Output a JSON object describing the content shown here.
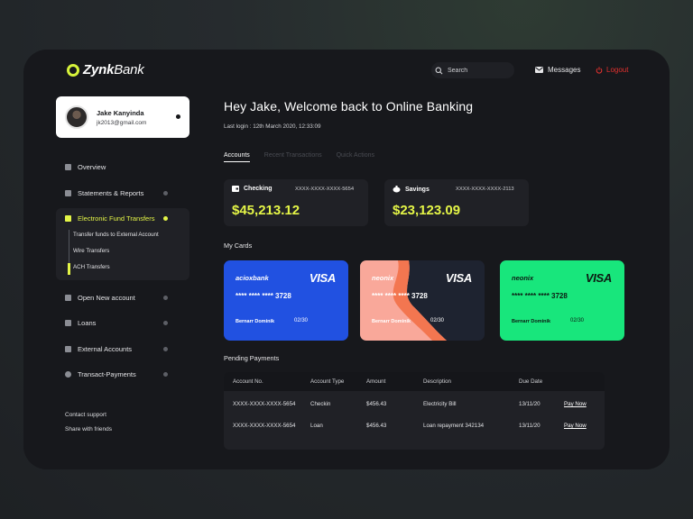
{
  "brand": {
    "name_bold": "Zynk",
    "name_light": "Bank"
  },
  "header": {
    "search_placeholder": "Search",
    "messages_label": "Messages",
    "logout_label": "Logout"
  },
  "profile": {
    "name": "Jake Kanyinda",
    "email": "jk2013@gmail.com"
  },
  "sidebar": {
    "items": [
      {
        "label": "Overview"
      },
      {
        "label": "Statements & Reports"
      },
      {
        "label": "Electronic Fund Transfers"
      },
      {
        "label": "Open New account"
      },
      {
        "label": "Loans"
      },
      {
        "label": "External Accounts"
      },
      {
        "label": "Transact-Payments"
      }
    ],
    "sub_items": [
      {
        "label": "Transfer funds to External Account"
      },
      {
        "label": "Wire Transfers"
      },
      {
        "label": "ACH Transfers"
      }
    ],
    "footer_links": [
      "Contact support",
      "Share with friends"
    ]
  },
  "main": {
    "welcome": "Hey Jake, Welcome back to Online Banking",
    "last_login": "Last login : 12th March 2020, 12:33:09",
    "tabs": [
      "Accounts",
      "Recent Transactions",
      "Quick Actions"
    ],
    "accounts": [
      {
        "name": "Checking",
        "number": "XXXX-XXXX-XXXX-5654",
        "balance": "$45,213.12"
      },
      {
        "name": "Savings",
        "number": "XXXX-XXXX-XXXX-2113",
        "balance": "$23,123.09"
      }
    ],
    "my_cards_title": "My Cards",
    "cards": [
      {
        "brand": "acioxbank",
        "network": "VISA",
        "number": "**** **** **** 3728",
        "holder": "Bernarr Dominik",
        "expiry": "02/30",
        "color": "#2151e1"
      },
      {
        "brand": "neonix",
        "network": "VISA",
        "number": "**** **** **** 3728",
        "holder": "Bernarr Dominik",
        "expiry": "02/30",
        "color": "#f9a89a"
      },
      {
        "brand": "neonix",
        "network": "VISA",
        "number": "**** **** **** 3728",
        "holder": "Bernarr Dominik",
        "expiry": "02/30",
        "color": "#18e67c"
      }
    ],
    "pending_title": "Pending Payments",
    "table": {
      "headers": [
        "Account No.",
        "Account Type",
        "Amount",
        "Description",
        "Due Date"
      ],
      "rows": [
        {
          "account": "XXXX-XXXX-XXXX-5654",
          "type": "Checkin",
          "amount": "$456.43",
          "description": "Electricity Bill",
          "due": "13/11/20",
          "action": "Pay Now"
        },
        {
          "account": "XXXX-XXXX-XXXX-5654",
          "type": "Loan",
          "amount": "$456.43",
          "description": "Loan repayment 342134",
          "due": "13/11/20",
          "action": "Pay Now"
        }
      ]
    }
  },
  "colors": {
    "accent": "#e4f547",
    "logout": "#e2312e",
    "panel": "#17181c"
  }
}
